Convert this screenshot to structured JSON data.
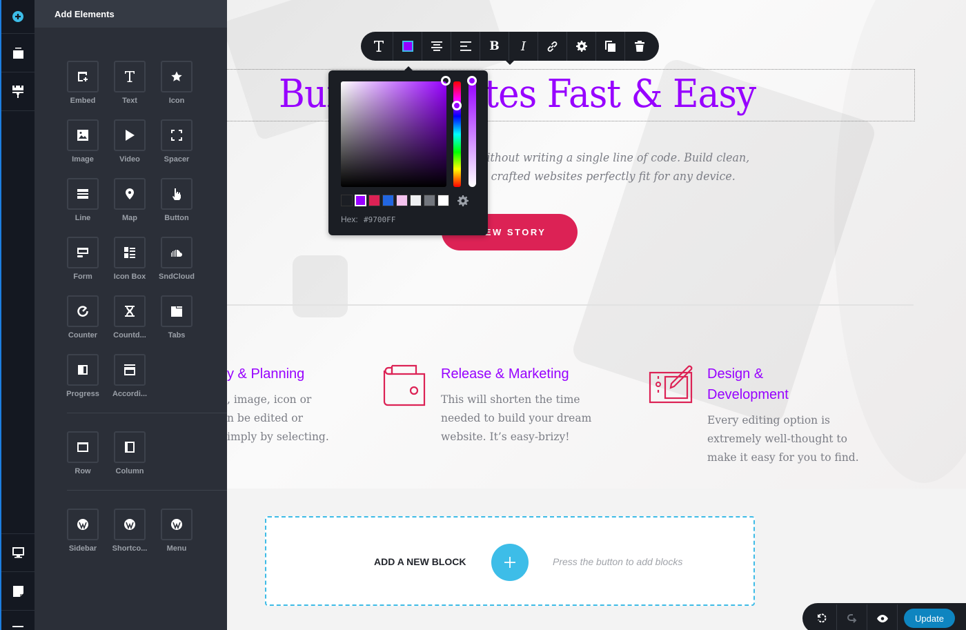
{
  "rail": {
    "items": [
      {
        "name": "add-elements",
        "icon": "plus-circle-icon"
      },
      {
        "name": "blocks",
        "icon": "layers-icon"
      },
      {
        "name": "styling",
        "icon": "paint-roller-icon"
      },
      {
        "name": "responsive",
        "icon": "monitor-icon"
      },
      {
        "name": "pages",
        "icon": "page-icon"
      },
      {
        "name": "more",
        "icon": "menu-icon"
      }
    ]
  },
  "panel": {
    "title": "Add Elements",
    "basic": [
      {
        "label": "Embed",
        "icon": "embed-icon"
      },
      {
        "label": "Text",
        "icon": "text-icon"
      },
      {
        "label": "Icon",
        "icon": "star-icon"
      },
      {
        "label": "Image",
        "icon": "image-icon"
      },
      {
        "label": "Video",
        "icon": "play-icon"
      },
      {
        "label": "Spacer",
        "icon": "spacer-icon"
      },
      {
        "label": "Line",
        "icon": "line-icon"
      },
      {
        "label": "Map",
        "icon": "map-pin-icon"
      },
      {
        "label": "Button",
        "icon": "hand-pointer-icon"
      },
      {
        "label": "Form",
        "icon": "form-icon"
      },
      {
        "label": "Icon Box",
        "icon": "icon-box-icon"
      },
      {
        "label": "SndCloud",
        "icon": "soundcloud-icon"
      },
      {
        "label": "Counter",
        "icon": "counter-icon"
      },
      {
        "label": "Countd...",
        "icon": "hourglass-icon"
      },
      {
        "label": "Tabs",
        "icon": "tabs-icon"
      },
      {
        "label": "Progress",
        "icon": "progress-icon"
      },
      {
        "label": "Accordi...",
        "icon": "accordion-icon"
      }
    ],
    "layout": [
      {
        "label": "Row",
        "icon": "row-icon"
      },
      {
        "label": "Column",
        "icon": "column-icon"
      }
    ],
    "wordpress": [
      {
        "label": "Sidebar",
        "icon": "wordpress-icon"
      },
      {
        "label": "Shortco...",
        "icon": "wordpress-icon"
      },
      {
        "label": "Menu",
        "icon": "wordpress-icon"
      }
    ]
  },
  "toolbar": {
    "items": [
      {
        "name": "typography",
        "icon": "text-icon"
      },
      {
        "name": "color",
        "icon": "color-swatch-icon"
      },
      {
        "name": "align-center",
        "icon": "align-center-icon"
      },
      {
        "name": "list",
        "icon": "list-icon"
      },
      {
        "name": "bold",
        "icon": "bold-icon"
      },
      {
        "name": "italic",
        "icon": "italic-icon"
      },
      {
        "name": "link",
        "icon": "link-icon"
      },
      {
        "name": "settings",
        "icon": "gear-icon"
      },
      {
        "name": "duplicate",
        "icon": "duplicate-icon"
      },
      {
        "name": "delete",
        "icon": "trash-icon"
      }
    ],
    "current_color": "#9700FF"
  },
  "color_picker": {
    "swatches": [
      "#1b1e24",
      "#9700ff",
      "#dc2255",
      "#2266e0",
      "#f4c3ef",
      "#eff0f2",
      "#72767d",
      "#ffffff"
    ],
    "selected_swatch": 1,
    "hex_label": "Hex:",
    "hex_value": "#9700FF"
  },
  "hero": {
    "title": "Build Websites Fast & Easy",
    "subtitle_line1": "Create websites visually without writing a single line of code. Build clean,",
    "subtitle_line2": "minimalist and carefully crafted websites perfectly fit for any device.",
    "button_label": "VIEW STORY"
  },
  "features": [
    {
      "title": "y & Planning",
      "lines": [
        ", image, icon or",
        "n be edited or",
        "imply by selecting."
      ]
    },
    {
      "title": "Release & Marketing",
      "lines": [
        "This will shorten the time",
        "needed to build your dream",
        "website. It’s easy-brizy!"
      ],
      "icon": "wallet-icon"
    },
    {
      "title_line1": "Design &",
      "title_line2": "Development",
      "lines": [
        "Every editing option is",
        "extremely well-thought to",
        "make it easy for you to find."
      ],
      "icon": "design-tablet-icon"
    }
  ],
  "addblock": {
    "label": "ADD A NEW BLOCK",
    "hint": "Press the button to add blocks"
  },
  "bottombar": {
    "update_label": "Update"
  },
  "colors": {
    "accent_purple": "#9700ff",
    "accent_pink": "#dc2255",
    "accent_blue": "#3dbde8",
    "update_blue": "#0e85c0"
  }
}
